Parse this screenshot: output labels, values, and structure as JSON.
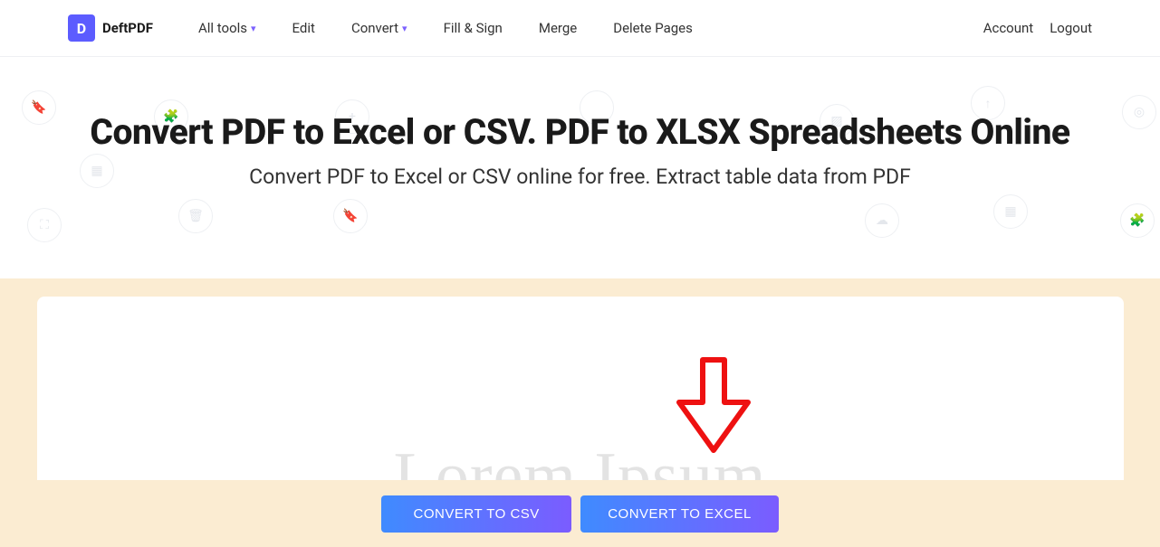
{
  "brand": {
    "logo_letter": "D",
    "name": "DeftPDF"
  },
  "nav": {
    "all_tools": "All tools",
    "edit": "Edit",
    "convert": "Convert",
    "fill_sign": "Fill & Sign",
    "merge": "Merge",
    "delete_pages": "Delete Pages"
  },
  "account": {
    "account": "Account",
    "logout": "Logout"
  },
  "hero": {
    "title": "Convert PDF to Excel or CSV. PDF to XLSX Spreadsheets Online",
    "subtitle": "Convert PDF to Excel or CSV online for free. Extract table data from PDF"
  },
  "watermark": "Lorem Ipsum",
  "actions": {
    "convert_csv": "CONVERT TO CSV",
    "convert_excel": "CONVERT TO EXCEL"
  },
  "bg_icons": {
    "bookmark": "🔖",
    "puzzle": "🧩",
    "plus": "+",
    "grid": "▦",
    "texture": "▨",
    "cloud": "☁",
    "crop": "⛶",
    "delete": "🗑",
    "tag": "🔖",
    "up": "↑"
  }
}
